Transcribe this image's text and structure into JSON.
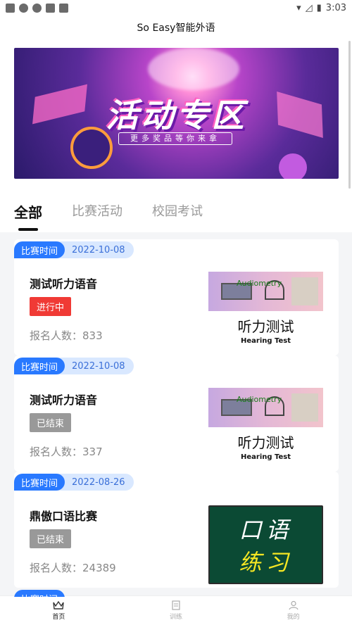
{
  "status_bar": {
    "time": "3:03"
  },
  "header": {
    "title": "So Easy智能外语"
  },
  "banner": {
    "title": "活动专区",
    "subtitle": "更多奖品等你来拿"
  },
  "tabs": [
    {
      "label": "全部",
      "active": true
    },
    {
      "label": "比赛活动",
      "active": false
    },
    {
      "label": "校园考试",
      "active": false
    }
  ],
  "cards": [
    {
      "tag": "比赛时间",
      "date": "2022-10-08",
      "title": "测试听力语音",
      "status": "进行中",
      "count": "报名人数：833",
      "image": {
        "label": "Audiometry",
        "cn": "听力测试",
        "en": "Hearing Test"
      }
    },
    {
      "tag": "比赛时间",
      "date": "2022-10-08",
      "title": "测试听力语音",
      "status": "已结束",
      "count": "报名人数：337",
      "image": {
        "label": "Audiometry",
        "cn": "听力测试",
        "en": "Hearing Test"
      }
    },
    {
      "tag": "比赛时间",
      "date": "2022-08-26",
      "title": "鼎傲口语比赛",
      "status": "已结束",
      "count": "报名人数：24389",
      "image": {
        "line1": "口语",
        "line2": "练习"
      }
    }
  ],
  "peek_tag": "比赛时间",
  "bottom_nav": [
    {
      "label": "首页",
      "icon": "crown-icon",
      "active": true
    },
    {
      "label": "训练",
      "icon": "clipboard-icon",
      "active": false
    },
    {
      "label": "我的",
      "icon": "person-icon",
      "active": false
    }
  ],
  "colors": {
    "accent": "#2979ff",
    "live": "#f03a35",
    "ended": "#999999"
  }
}
